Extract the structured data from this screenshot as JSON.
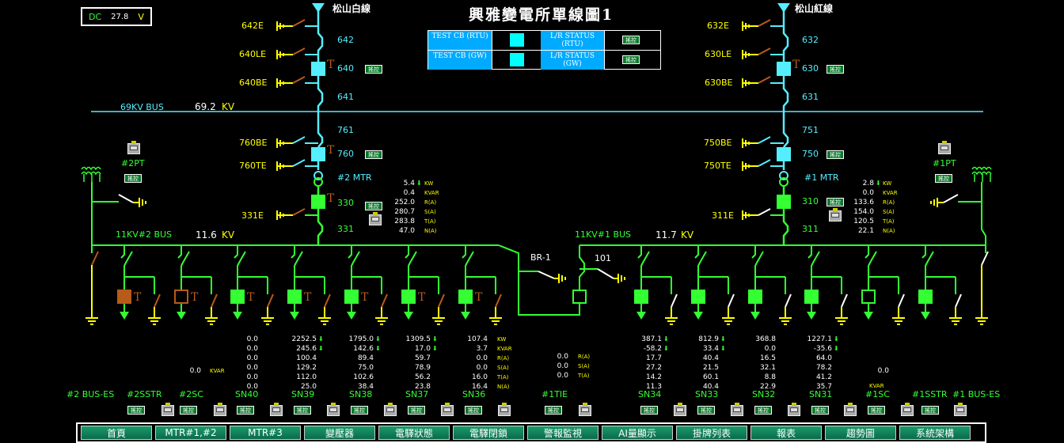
{
  "title": "興雅變電所單線圖1",
  "dc": {
    "label": "DC",
    "value": "27.8",
    "unit": "V"
  },
  "feeders": {
    "left": "松山白線",
    "right": "松山紅線"
  },
  "bus69": {
    "label": "69KV BUS",
    "value": "69.2",
    "unit": "KV"
  },
  "bus11_2": {
    "label": "11KV#2 BUS",
    "value": "11.6",
    "unit": "KV"
  },
  "bus11_1": {
    "label": "11KV#1 BUS",
    "value": "11.7",
    "unit": "KV"
  },
  "status": {
    "row1_left": "TEST CB (RTU)",
    "row1_right": "L/R STATUS (RTU)",
    "row2_left": "TEST CB (GW)",
    "row2_right": "L/R STATUS (GW)",
    "ctrl": "搖控"
  },
  "ctrl_label": "搖控",
  "breaker_labels": {
    "l642E": "642E",
    "l642": "642",
    "l640LE": "640LE",
    "l640": "640",
    "l640BE": "640BE",
    "l641": "641",
    "l761": "761",
    "l760BE": "760BE",
    "l760": "760",
    "l760TE": "760TE",
    "l2MTR": "#2 MTR",
    "l331E": "331E",
    "l330": "330",
    "l331": "331",
    "r632E": "632E",
    "r632": "632",
    "r630LE": "630LE",
    "r630": "630",
    "r630BE": "630BE",
    "r631": "631",
    "r751": "751",
    "r750BE": "750BE",
    "r750": "750",
    "r750TE": "750TE",
    "r1MTR": "#1 MTR",
    "r311E": "311E",
    "r310": "310",
    "r311": "311",
    "pt2": "#2PT",
    "pt1": "#1PT",
    "br1": "BR-1",
    "b101": "101",
    "T": "T"
  },
  "mtr2_meas": {
    "values": [
      "5.4",
      "0.4",
      "252.0",
      "280.7",
      "283.8",
      "47.0"
    ],
    "units": [
      "KW",
      "KVAR",
      "R(A)",
      "S(A)",
      "T(A)",
      "N(A)"
    ]
  },
  "mtr1_meas": {
    "values": [
      "2.8",
      "0.0",
      "133.6",
      "154.0",
      "120.5",
      "22.1"
    ],
    "units": [
      "KW",
      "KVAR",
      "R(A)",
      "S(A)",
      "T(A)",
      "N(A)"
    ]
  },
  "bays": [
    {
      "name": "#2 BUS-ES"
    },
    {
      "name": "#2SSTR"
    },
    {
      "name": "#2SC",
      "kvar": "0.0",
      "kvar_unit": "KVAR"
    },
    {
      "name": "SN40",
      "vals": [
        "0.0",
        "0.0",
        "0.0",
        "0.0",
        "0.0",
        "0.0"
      ]
    },
    {
      "name": "SN39",
      "vals": [
        "2252.5",
        "245.6",
        "100.4",
        "129.2",
        "112.0",
        "25.0"
      ]
    },
    {
      "name": "SN38",
      "vals": [
        "1795.0",
        "142.6",
        "89.4",
        "75.0",
        "102.6",
        "38.4"
      ]
    },
    {
      "name": "SN37",
      "vals": [
        "1309.5",
        "17.0",
        "59.7",
        "78.9",
        "56.2",
        "23.8"
      ]
    },
    {
      "name": "SN36",
      "vals": [
        "107.4",
        "3.7",
        "0.0",
        "0.0",
        "16.0",
        "16.4"
      ],
      "units": [
        "KW",
        "KVAR",
        "R(A)",
        "S(A)",
        "T(A)",
        "N(A)"
      ]
    },
    {
      "name": "#1TIE",
      "vals": [
        "0.0",
        "0.0",
        "0.0"
      ],
      "units": [
        "R(A)",
        "S(A)",
        "T(A)"
      ]
    },
    {
      "name": "SN34",
      "vals": [
        "387.1",
        "-58.2",
        "17.7",
        "27.2",
        "14.2",
        "11.3"
      ]
    },
    {
      "name": "SN33",
      "vals": [
        "812.9",
        "33.4",
        "40.4",
        "21.5",
        "60.1",
        "40.4"
      ]
    },
    {
      "name": "SN32",
      "vals": [
        "368.8",
        "0.0",
        "16.5",
        "32.1",
        "8.8",
        "22.9"
      ]
    },
    {
      "name": "SN31",
      "vals": [
        "1227.1",
        "-35.6",
        "64.0",
        "78.2",
        "41.2",
        "35.7"
      ]
    },
    {
      "name": "#1SC",
      "kvar": "0.0",
      "kvar_unit": "KVAR"
    },
    {
      "name": "#1SSTR"
    },
    {
      "name": "#1 BUS-ES"
    }
  ],
  "nav": [
    "首頁",
    "MTR#1,#2",
    "MTR#3",
    "變壓器",
    "電驛狀態",
    "電驛閉鎖",
    "警報監視",
    "AI量顯示",
    "掛牌列表",
    "報表",
    "趨勢圖",
    "系統架構"
  ],
  "colors": {
    "energized": "#33ff33",
    "hv": "#55eeff",
    "ground": "#ffff00",
    "open": "#ffffff",
    "brown": "#b85a1a"
  }
}
